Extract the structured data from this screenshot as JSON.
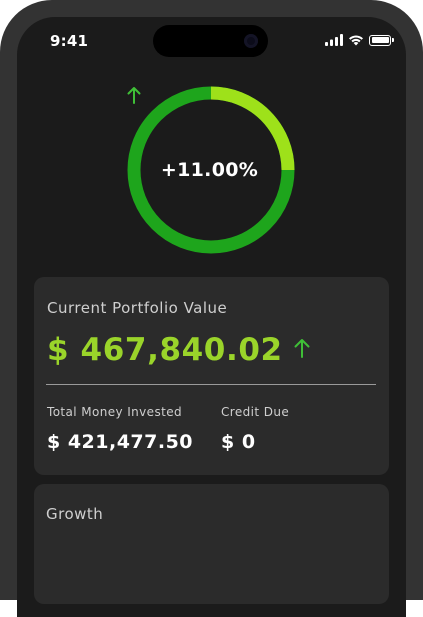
{
  "status_bar": {
    "time": "9:41",
    "icons": [
      "signal-icon",
      "wifi-icon",
      "battery-icon"
    ]
  },
  "growth_ring": {
    "percent_text": "+11.00%",
    "trend_icon": "arrow-up-icon",
    "colors": {
      "primary": "#1ea51c",
      "highlight": "#9ee11a"
    }
  },
  "portfolio": {
    "title": "Current Portfolio Value",
    "value": "$ 467,840.02",
    "trend_icon": "arrow-up-icon",
    "value_color": "#9ad42a",
    "stats": {
      "invested_label": "Total Money Invested",
      "invested_value": "$ 421,477.50",
      "credit_label": "Credit Due",
      "credit_value": "$ 0"
    }
  },
  "growth": {
    "title": "Growth"
  }
}
